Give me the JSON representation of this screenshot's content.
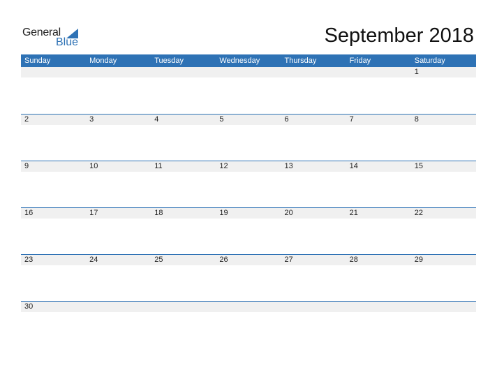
{
  "logo": {
    "line1": "General",
    "line2": "Blue"
  },
  "title": "September 2018",
  "colors": {
    "accent": "#2e72b5",
    "day_row_bg": "#f0f0f0"
  },
  "weekdays": [
    "Sunday",
    "Monday",
    "Tuesday",
    "Wednesday",
    "Thursday",
    "Friday",
    "Saturday"
  ],
  "weeks": [
    [
      "",
      "",
      "",
      "",
      "",
      "",
      "1"
    ],
    [
      "2",
      "3",
      "4",
      "5",
      "6",
      "7",
      "8"
    ],
    [
      "9",
      "10",
      "11",
      "12",
      "13",
      "14",
      "15"
    ],
    [
      "16",
      "17",
      "18",
      "19",
      "20",
      "21",
      "22"
    ],
    [
      "23",
      "24",
      "25",
      "26",
      "27",
      "28",
      "29"
    ],
    [
      "30",
      "",
      "",
      "",
      "",
      "",
      ""
    ]
  ]
}
